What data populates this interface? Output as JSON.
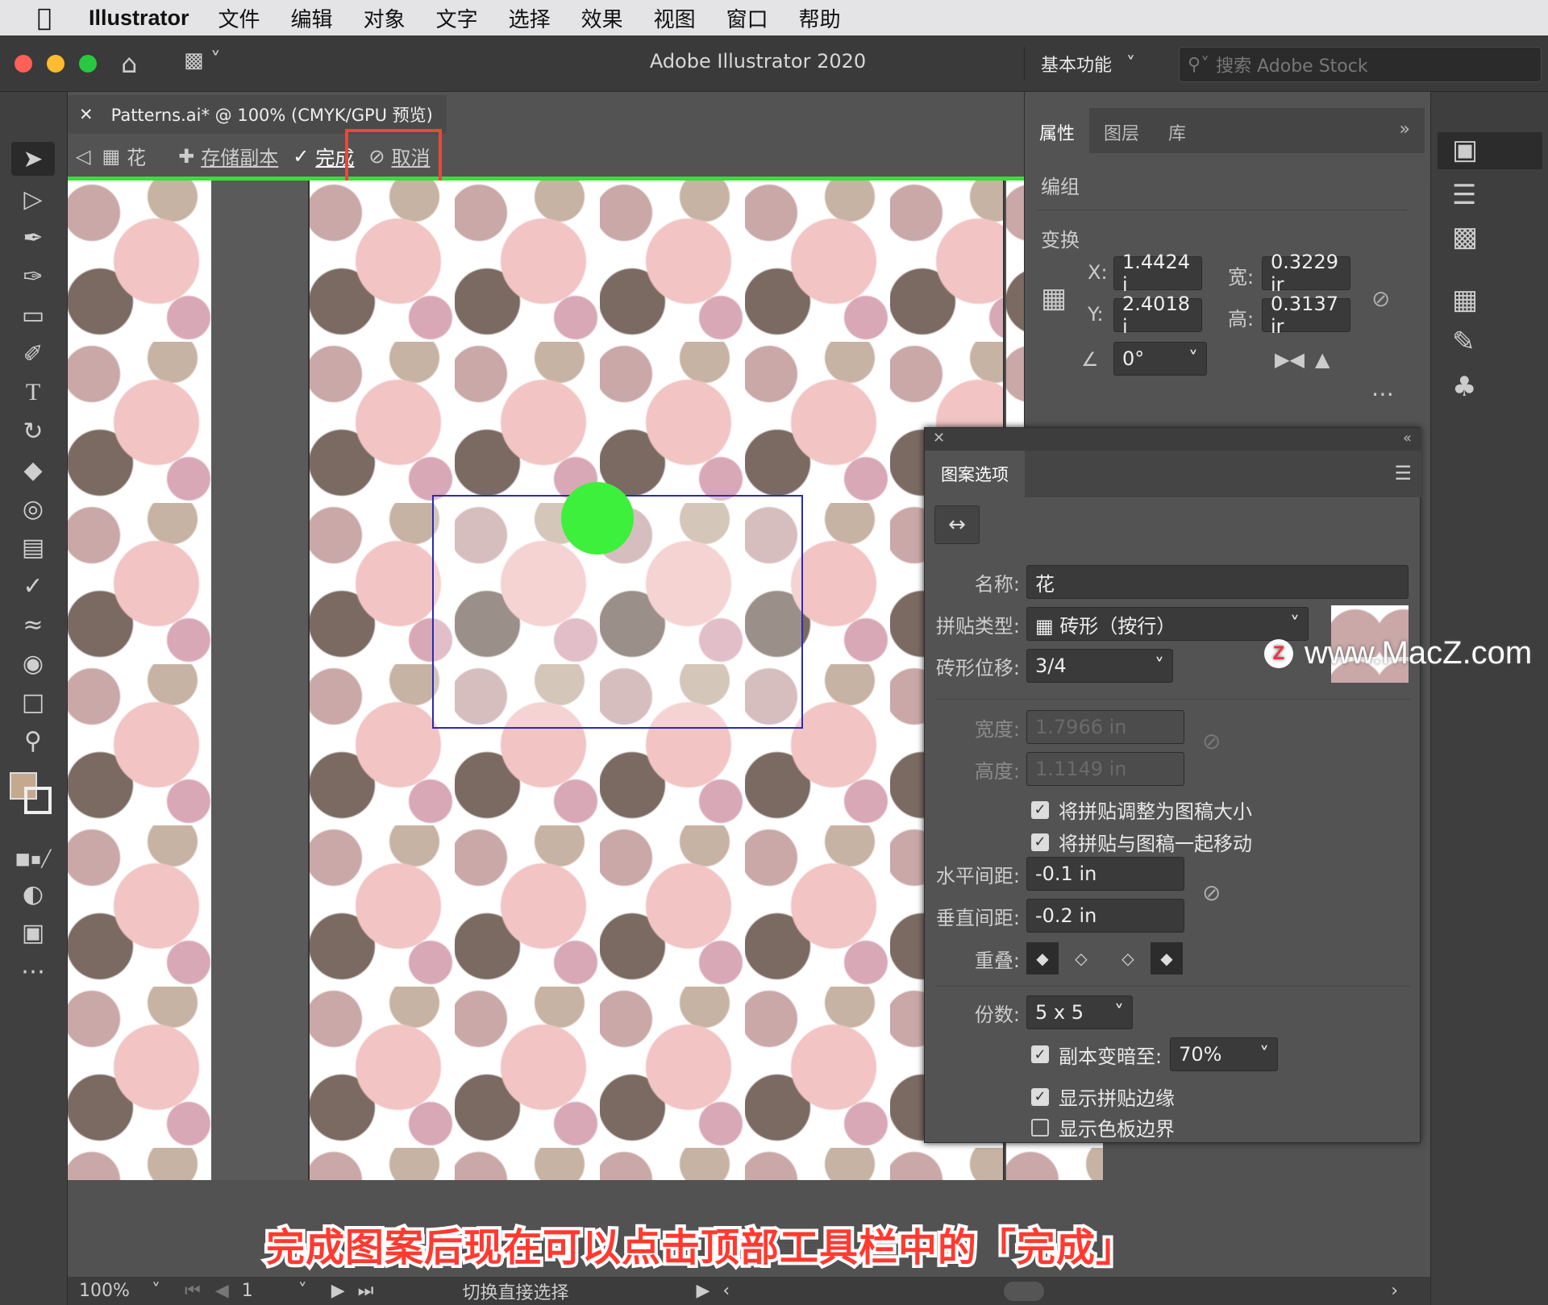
{
  "menubar": {
    "app": "Illustrator",
    "items": [
      "文件",
      "编辑",
      "对象",
      "文字",
      "选择",
      "效果",
      "视图",
      "窗口",
      "帮助"
    ]
  },
  "titlebar": {
    "title": "Adobe Illustrator 2020",
    "workspace": "基本功能",
    "search_placeholder": "搜索 Adobe Stock"
  },
  "doc": {
    "tab": "Patterns.ai* @ 100% (CMYK/GPU 预览)"
  },
  "isolation": {
    "pattern_name": "花",
    "save_copy": "存储副本",
    "done": "完成",
    "cancel": "取消"
  },
  "properties": {
    "tabs": [
      "属性",
      "图层",
      "库"
    ],
    "group_label": "编组",
    "transform_label": "变换",
    "x_label": "X:",
    "x": "1.4424 i",
    "y_label": "Y:",
    "y": "2.4018 i",
    "w_label": "宽:",
    "w": "0.3229 ir",
    "h_label": "高:",
    "h": "0.3137 ir",
    "angle": "0°"
  },
  "pattern_options": {
    "title": "图案选项",
    "name_label": "名称:",
    "name": "花",
    "tile_type_label": "拼贴类型:",
    "tile_type": "砖形（按行）",
    "brick_offset_label": "砖形位移:",
    "brick_offset": "3/4",
    "width_label": "宽度:",
    "width": "1.7966 in",
    "height_label": "高度:",
    "height": "1.1149 in",
    "size_tile_to_art": "将拼贴调整为图稿大小",
    "move_tile_with_art": "将拼贴与图稿一起移动",
    "h_spacing_label": "水平间距:",
    "h_spacing": "-0.1 in",
    "v_spacing_label": "垂直间距:",
    "v_spacing": "-0.2 in",
    "overlap_label": "重叠:",
    "copies_label": "份数:",
    "copies": "5 x 5",
    "dim_copies": "副本变暗至:",
    "dim_value": "70%",
    "show_tile_edge": "显示拼贴边缘",
    "show_swatch_bounds": "显示色板边界",
    "checks": {
      "size_tile": true,
      "move_tile": true,
      "dim": true,
      "tile_edge": true,
      "swatch_bounds": false
    }
  },
  "watermark": "www.MacZ.com",
  "caption": "完成图案后现在可以点击顶部工具栏中的「完成」",
  "status": {
    "zoom": "100%",
    "page": "1",
    "tool": "切换直接选择"
  },
  "colors": {
    "accent_green": "#3ddc3d",
    "highlight_red": "#e34b3b",
    "caption_red": "#ff3a30"
  }
}
